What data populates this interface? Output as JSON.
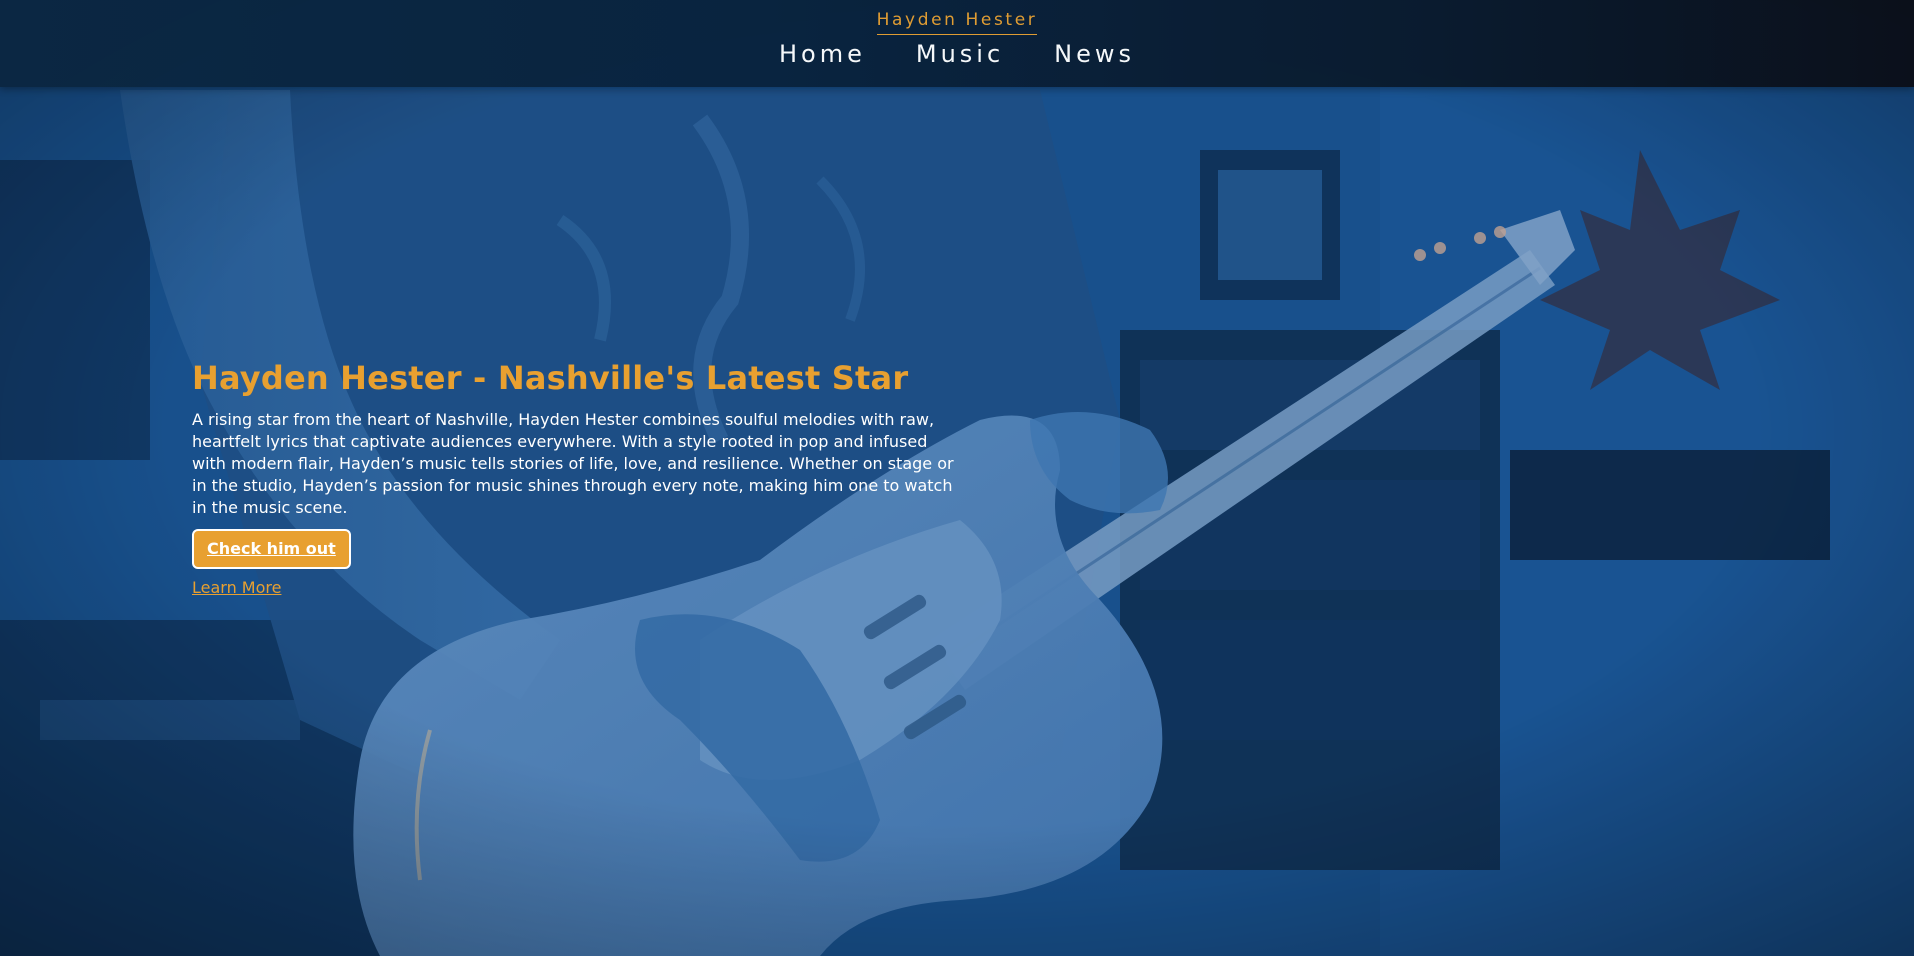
{
  "header": {
    "brand": "Hayden Hester",
    "nav": [
      {
        "label": "Home"
      },
      {
        "label": "Music"
      },
      {
        "label": "News"
      }
    ]
  },
  "hero": {
    "title": "Hayden Hester - Nashville's Latest Star",
    "description": "A rising star from the heart of Nashville, Hayden Hester combines soulful melodies with raw, heartfelt lyrics that captivate audiences everywhere. With a style rooted in pop and infused with modern flair, Hayden’s music tells stories of life, love, and resilience. Whether on stage or in the studio, Hayden’s passion for music shines through every note, making him one to watch in the music scene.",
    "primary_button": "Check him out",
    "secondary_link": "Learn More"
  },
  "colors": {
    "accent": "#e8a030",
    "nav_text": "#ffffff",
    "background_tint": "#174d86"
  }
}
